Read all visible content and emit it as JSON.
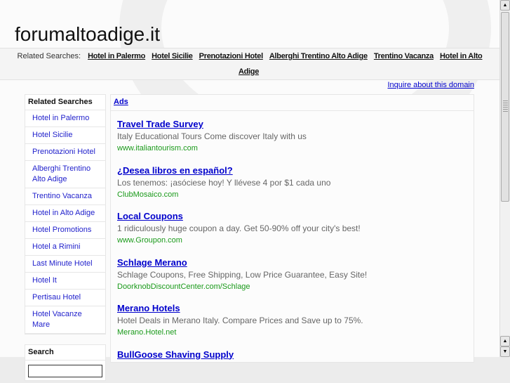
{
  "site_title": "forumaltoadige.it",
  "related": {
    "label": "Related Searches:",
    "links": [
      "Hotel in Palermo",
      "Hotel Sicilie",
      "Prenotazioni Hotel",
      "Alberghi Trentino Alto Adige",
      "Trentino Vacanza",
      "Hotel in Alto Adige"
    ]
  },
  "inquire": "Inquire about this domain",
  "sidebar": {
    "title": "Related Searches",
    "items": [
      "Hotel in Palermo",
      "Hotel Sicilie",
      "Prenotazioni Hotel",
      "Alberghi Trentino Alto Adige",
      "Trentino Vacanza",
      "Hotel in Alto Adige",
      "Hotel Promotions",
      "Hotel a Rimini",
      "Last Minute Hotel",
      "Hotel It",
      "Pertisau Hotel",
      "Hotel Vacanze Mare"
    ],
    "search_title": "Search"
  },
  "ads": {
    "header": "Ads",
    "items": [
      {
        "title": "Travel Trade Survey",
        "desc": "Italy Educational Tours Come discover Italy with us",
        "url": "www.italiantourism.com"
      },
      {
        "title": "¿Desea libros en español?",
        "desc": "Los tenemos: ¡asóciese hoy! Y llévese 4 por $1 cada uno",
        "url": "ClubMosaico.com"
      },
      {
        "title": "Local Coupons",
        "desc": "1 ridiculously huge coupon a day. Get 50-90% off your city's best!",
        "url": "www.Groupon.com"
      },
      {
        "title": "Schlage Merano",
        "desc": "Schlage Coupons, Free Shipping, Low Price Guarantee, Easy Site!",
        "url": "DoorknobDiscountCenter.com/Schlage"
      },
      {
        "title": "Merano Hotels",
        "desc": "Hotel Deals in Merano Italy. Compare Prices and Save up to 75%.",
        "url": "Merano.Hotel.net"
      },
      {
        "title": "BullGoose Shaving Supply",
        "desc": "",
        "url": ""
      }
    ]
  }
}
